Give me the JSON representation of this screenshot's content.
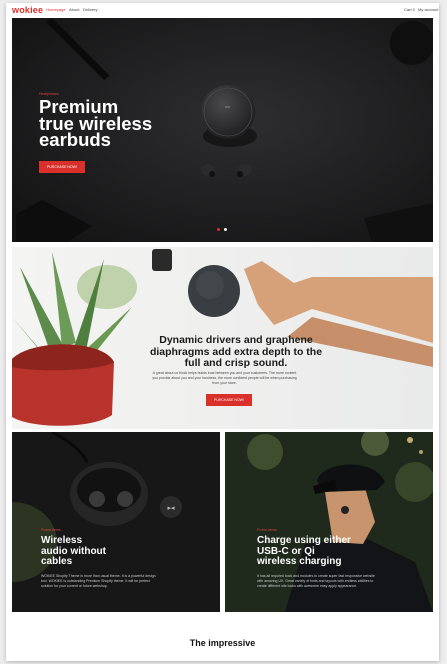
{
  "header": {
    "logo": "wokiee",
    "nav": [
      {
        "label": "Homepage",
        "active": true
      },
      {
        "label": "About",
        "active": false
      },
      {
        "label": "Delivery",
        "active": false
      }
    ],
    "cart_label": "Cart 0",
    "account_label": "My account"
  },
  "hero": {
    "kicker": "Headphones",
    "title_lines": [
      "Premium",
      "true wireless",
      "earbuds"
    ],
    "button": "PURCHASE NOW!",
    "slide_count": 2,
    "active_slide": 1
  },
  "feature": {
    "title_lines": [
      "Dynamic drivers and graphene",
      "diaphragms add extra depth to the",
      "full and crisp sound."
    ],
    "body_lines": [
      "A great about us block helps builds trust between you and your customers. The more content",
      "you provide about you and your business, the more confident people will be when purchasing",
      "from your store."
    ],
    "button": "PURCHASE NOW!"
  },
  "cards": [
    {
      "kicker": "Promo items",
      "title_lines": [
        "Wireless",
        "audio without",
        "cables"
      ],
      "body_lines": [
        "WOKIEE Shopify Theme is more than usual theme. It is a powerful design",
        "tool. WOKIEE is outstanding Premium Shopify theme. It will be perfect",
        "solution for your current or future webshop."
      ]
    },
    {
      "kicker": "Promo items",
      "title_lines": [
        "Charge using either",
        "USB-C or Qi",
        "wireless charging"
      ],
      "body_lines": [
        "It has all required tools and modules to create super fast responsive website",
        "with amazing UX. Great variety of fonts and layouts with endless abilities to",
        "create different site looks with awesome easy apply appearance."
      ]
    }
  ],
  "bottom_title": "The impressive",
  "colors": {
    "accent": "#d9302c",
    "hero_bg": "#1e1e1f"
  }
}
